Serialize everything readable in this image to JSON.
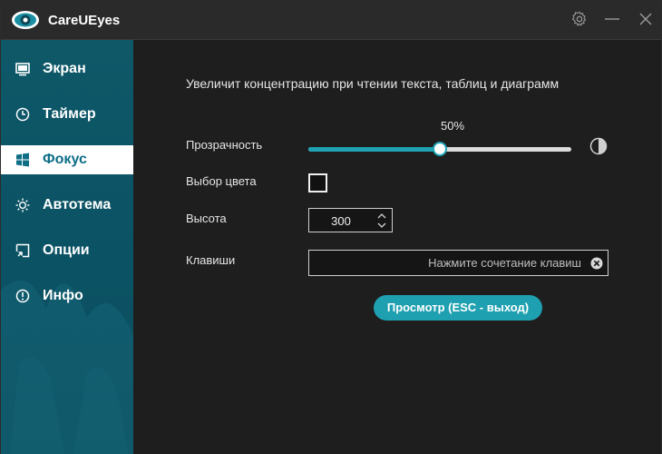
{
  "app": {
    "title": "CareUEyes"
  },
  "sidebar": {
    "items": [
      {
        "label": "Экран",
        "icon": "monitor-icon",
        "active": false
      },
      {
        "label": "Таймер",
        "icon": "clock-icon",
        "active": false
      },
      {
        "label": "Фокус",
        "icon": "windows-icon",
        "active": true
      },
      {
        "label": "Автотема",
        "icon": "sun-icon",
        "active": false
      },
      {
        "label": "Опции",
        "icon": "options-icon",
        "active": false
      },
      {
        "label": "Инфо",
        "icon": "info-icon",
        "active": false
      }
    ]
  },
  "main": {
    "headline": "Увеличит концентрацию при чтении текста, таблиц и диаграмм",
    "transparency": {
      "label": "Прозрачность",
      "value_text": "50%",
      "value": 0.5
    },
    "color": {
      "label": "Выбор цвета"
    },
    "height": {
      "label": "Высота",
      "value": "300"
    },
    "hotkeys": {
      "label": "Клавиши",
      "placeholder": "Нажмите сочетание клавиш"
    },
    "preview_button": "Просмотр (ESC - выход)"
  },
  "colors": {
    "accent": "#1ea0b0",
    "sidebar": "#0b5264",
    "active_text": "#0d6e86"
  }
}
